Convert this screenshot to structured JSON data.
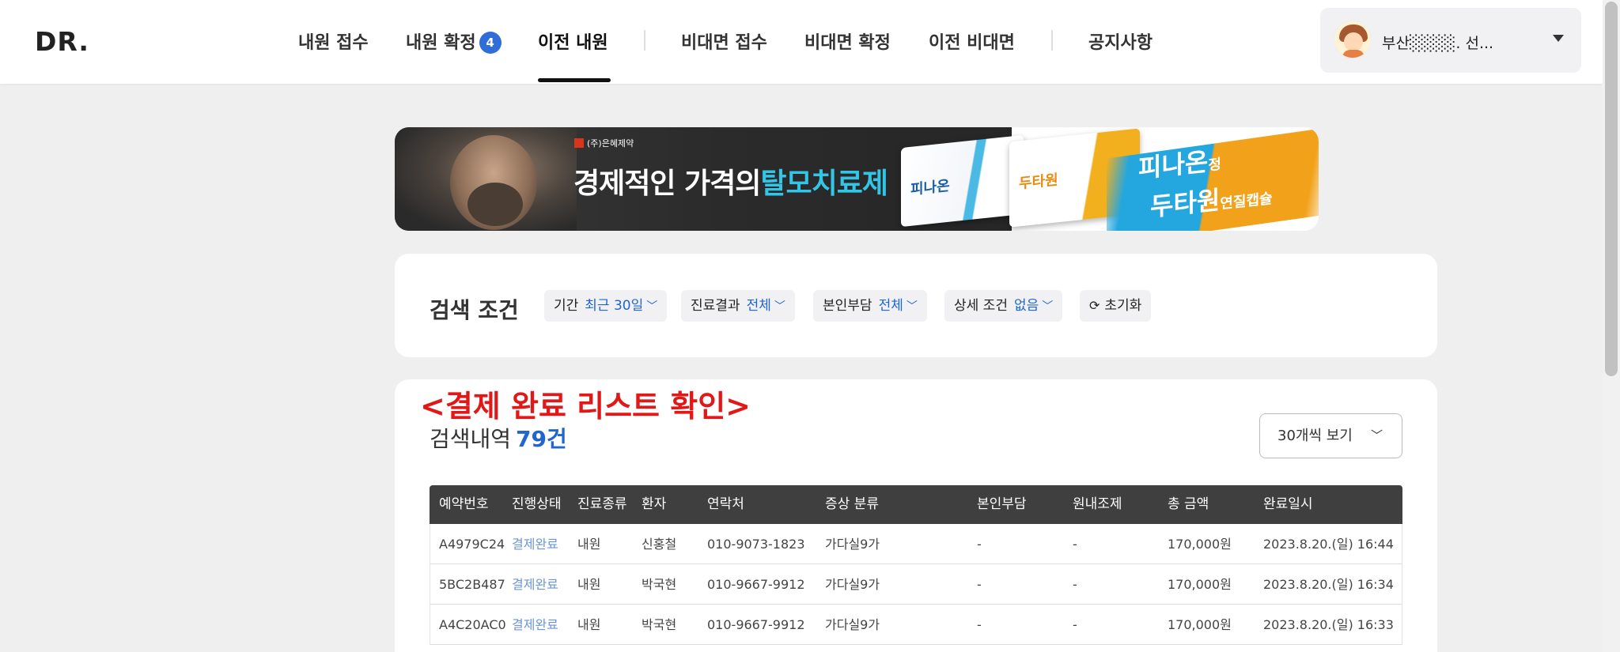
{
  "header": {
    "logo": "DR.",
    "nav": [
      {
        "label": "내원 접수"
      },
      {
        "label": "내원 확정",
        "badge": "4"
      },
      {
        "label": "이전 내원",
        "active": true
      },
      {
        "label": "비대면 접수"
      },
      {
        "label": "비대면 확정"
      },
      {
        "label": "이전 비대면"
      },
      {
        "label": "공지사항"
      }
    ],
    "user": {
      "name": "부산░░░░. 선..."
    }
  },
  "banner": {
    "brand": "(주)은혜제약",
    "text_prefix": "경제적인 가격의",
    "text_highlight": "탈모치료제",
    "product1": "피나온",
    "product1_suffix": "정",
    "product2": "두타원",
    "product2_suffix": "연질캡슐"
  },
  "search": {
    "title": "검색 조건",
    "filters": [
      {
        "label": "기간",
        "value": "최근 30일"
      },
      {
        "label": "진료결과",
        "value": "전체"
      },
      {
        "label": "본인부담",
        "value": "전체"
      },
      {
        "label": "상세 조건",
        "value": "없음"
      }
    ],
    "reset_label": "초기화"
  },
  "results": {
    "annotation": "<결제 완료 리스트 확인>",
    "title": "검색내역",
    "count": "79건",
    "page_size": "30개씩 보기",
    "columns": [
      "예약번호",
      "진행상태",
      "진료종류",
      "환자",
      "연락처",
      "증상 분류",
      "본인부담",
      "원내조제",
      "총 금액",
      "완료일시"
    ],
    "rows": [
      [
        "A4979C24",
        "결제완료",
        "내원",
        "신홍철",
        "010-9073-1823",
        "가다실9가",
        "-",
        "-",
        "170,000원",
        "2023.8.20.(일) 16:44"
      ],
      [
        "5BC2B487",
        "결제완료",
        "내원",
        "박국현",
        "010-9667-9912",
        "가다실9가",
        "-",
        "-",
        "170,000원",
        "2023.8.20.(일) 16:34"
      ],
      [
        "A4C20AC0",
        "결제완료",
        "내원",
        "박국현",
        "010-9667-9912",
        "가다실9가",
        "-",
        "-",
        "170,000원",
        "2023.8.20.(일) 16:33"
      ]
    ]
  },
  "colors": {
    "accent": "#1f66d1",
    "badge": "#2f6ed6",
    "annotation": "#e01818",
    "table_header": "#3f3f3f"
  }
}
